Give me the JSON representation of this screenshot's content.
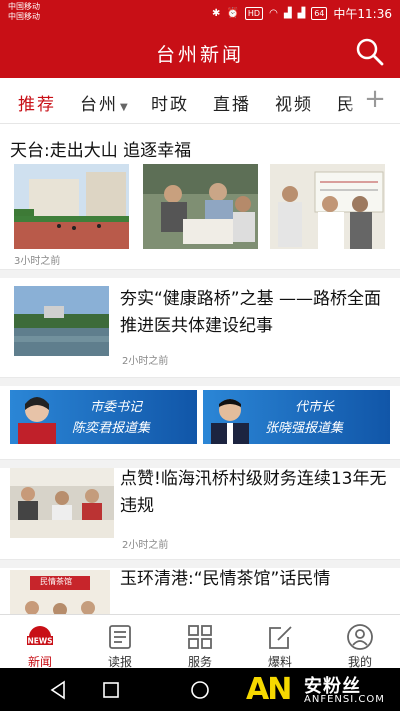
{
  "status_bar": {
    "carrier_1": "中国移动",
    "carrier_2": "中国移动",
    "icons": [
      "bluetooth-icon",
      "alarm-icon",
      "hd-icon",
      "wifi-icon",
      "signal-icon",
      "signal-icon"
    ],
    "hd": "HD",
    "battery": "64",
    "clock": "中午11:36"
  },
  "header": {
    "title": "台州新闻",
    "search_icon": "search-icon"
  },
  "tabs": [
    {
      "label": "推荐",
      "active": true
    },
    {
      "label": "台州",
      "has_dropdown": true
    },
    {
      "label": "时政"
    },
    {
      "label": "直播"
    },
    {
      "label": "视频"
    },
    {
      "label": "民"
    }
  ],
  "add_tab": "+",
  "feed": {
    "article_1": {
      "title": "天台:走出大山 追逐幸福",
      "time": "3小时之前"
    },
    "article_2": {
      "title": "夯实“健康路桥”之基 ——路桥全面推进医共体建设纪事",
      "time": "2小时之前"
    },
    "banners": {
      "left": {
        "title": "市委书记",
        "name": "陈奕君报道集"
      },
      "right": {
        "title": "代市长",
        "name": "张晓强报道集"
      }
    },
    "article_3": {
      "title": "点赞!临海汛桥村级财务连续13年无违规",
      "time": "2小时之前"
    },
    "article_4": {
      "title": "玉环清港:“民情茶馆”话民情",
      "sign": "民情茶馆"
    }
  },
  "bottom_nav": [
    {
      "label": "新闻",
      "icon": "news-icon",
      "active": true,
      "badge": "NEWS"
    },
    {
      "label": "读报",
      "icon": "newspaper-icon"
    },
    {
      "label": "服务",
      "icon": "grid-icon"
    },
    {
      "label": "爆料",
      "icon": "edit-icon"
    },
    {
      "label": "我的",
      "icon": "user-icon"
    }
  ],
  "watermark": {
    "logo": "AN",
    "cn": "安粉丝",
    "en": "ANFENSI.COM"
  },
  "colors": {
    "brand_red": "#c80f16",
    "banner_blue": "#1a6fc4"
  }
}
